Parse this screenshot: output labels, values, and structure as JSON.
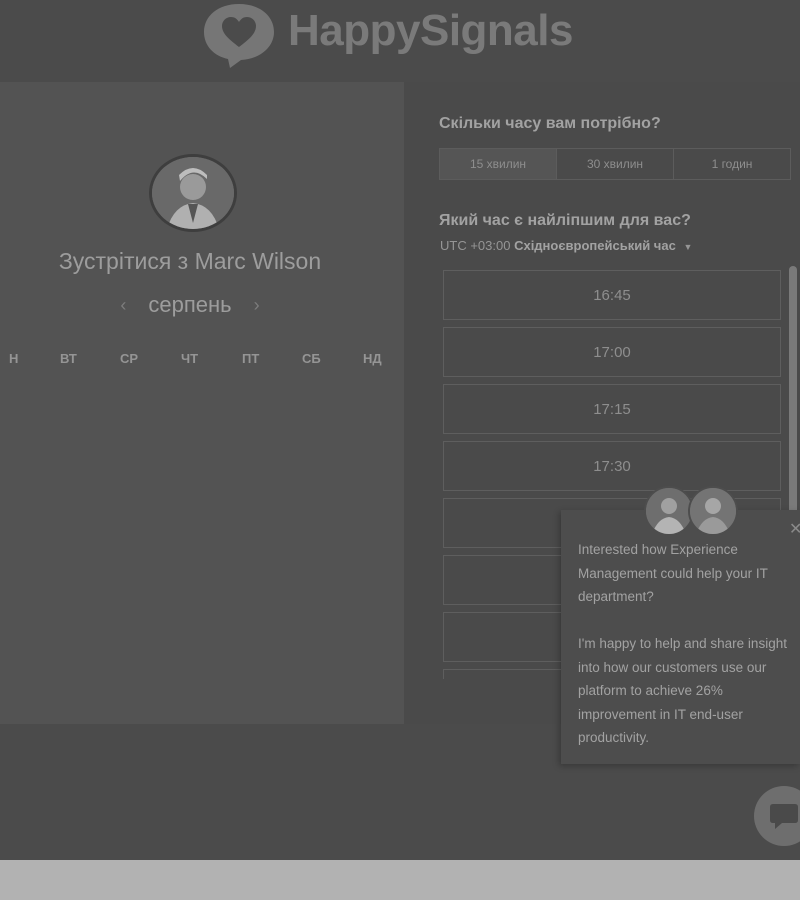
{
  "header": {
    "logo_text": "HappySignals"
  },
  "scheduler": {
    "meet_title": "Зустрітися з Marc Wilson",
    "month": "серпень",
    "prev_month_icon": "chevron-left-icon",
    "next_month_icon": "chevron-right-icon",
    "weekdays": [
      "Н",
      "ВТ",
      "СР",
      "ЧТ",
      "ПТ",
      "СБ",
      "НД"
    ]
  },
  "booking": {
    "duration_question": "Скільки часу вам потрібно?",
    "durations": [
      "15 хвилин",
      "30 хвилин",
      "1 годин"
    ],
    "selected_duration": "15 хвилин",
    "time_question": "Який час є найліпшим для вас?",
    "tz_offset": "UTC +03:00",
    "tz_name": "Східноєвропейський час",
    "slots": [
      "16:45",
      "17:00",
      "17:15",
      "17:30",
      "",
      "",
      "",
      ""
    ]
  },
  "chat": {
    "message_1": "Interested how Experience Management could help your IT department?",
    "message_2": "I'm happy to help and share insight into how our customers use our platform to achieve 26% improvement in IT end-user productivity.",
    "close_icon": "close-icon",
    "launcher_icon": "chat-bubble-icon"
  },
  "colors": {
    "overlay_dark": "#4f4f4f",
    "footer": "#b2b2b2"
  }
}
